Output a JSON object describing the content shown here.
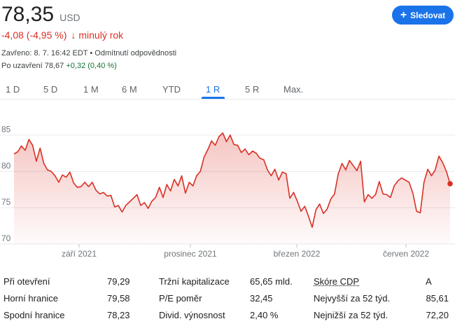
{
  "quote": {
    "price": "78,35",
    "currency": "USD",
    "change": "-4,08 (-4,95 %)",
    "change_arrow": "↓",
    "period": "minulý rok",
    "closed_text": "Zavřeno: 8. 7. 16:42 EDT",
    "separator": "•",
    "disclaimer": "Odmítnutí odpovědnosti",
    "after_hours_label": "Po uzavření 78,67",
    "after_hours_change": "+0,32 (0,40 %)"
  },
  "follow_button": {
    "icon": "plus-icon",
    "label": "Sledovat"
  },
  "range_tabs": [
    "1 D",
    "5 D",
    "1 M",
    "6 M",
    "YTD",
    "1 R",
    "5 R",
    "Max."
  ],
  "active_range": "1 R",
  "colors": {
    "line": "#d93025",
    "accent": "#1a73e8",
    "negative": "#d93025",
    "positive": "#137333"
  },
  "chart_data": {
    "type": "area",
    "y_ticks": [
      "85",
      "80",
      "75",
      "70"
    ],
    "ylim": [
      70,
      87
    ],
    "x_ticks": [
      "září 2021",
      "prosinec 2021",
      "březen 2022",
      "červen 2022"
    ],
    "grid": true,
    "values": [
      82.4,
      82.7,
      83.5,
      82.9,
      84.4,
      83.6,
      81.4,
      83.2,
      81.1,
      80.2,
      80.0,
      79.4,
      78.5,
      79.5,
      79.2,
      79.9,
      78.4,
      77.8,
      77.9,
      78.5,
      77.9,
      78.5,
      77.4,
      76.9,
      77.1,
      76.6,
      76.7,
      75.1,
      75.3,
      74.4,
      75.3,
      75.8,
      76.3,
      76.8,
      75.3,
      75.7,
      74.9,
      75.9,
      76.4,
      77.8,
      76.4,
      78.2,
      77.3,
      78.9,
      78.0,
      79.4,
      77.0,
      78.5,
      78.0,
      79.4,
      80.0,
      82.0,
      83.0,
      84.2,
      83.6,
      84.8,
      85.3,
      84.1,
      85.0,
      83.7,
      83.6,
      82.6,
      83.1,
      82.3,
      82.8,
      82.5,
      81.8,
      81.6,
      80.2,
      79.4,
      80.3,
      78.8,
      79.9,
      79.7,
      76.3,
      77.1,
      75.9,
      74.5,
      75.2,
      73.8,
      72.3,
      74.7,
      75.5,
      74.2,
      74.8,
      76.2,
      76.9,
      79.7,
      81.1,
      80.2,
      81.5,
      80.8,
      80.1,
      81.4,
      75.8,
      76.8,
      76.3,
      76.8,
      78.6,
      76.9,
      76.8,
      76.4,
      78.0,
      78.7,
      79.1,
      78.8,
      78.5,
      77.0,
      74.5,
      74.3,
      78.5,
      80.3,
      79.4,
      80.2,
      82.1,
      81.2,
      80.0,
      78.3
    ]
  },
  "stats": [
    {
      "label": "Při otevření",
      "value": "79,29"
    },
    {
      "label": "Horní hranice",
      "value": "79,58"
    },
    {
      "label": "Spodní hranice",
      "value": "78,23"
    },
    {
      "label": "Tržní kapitalizace",
      "value": "65,65 mld."
    },
    {
      "label": "P/E poměr",
      "value": "32,45"
    },
    {
      "label": "Divid. výnosnost",
      "value": "2,40 %"
    },
    {
      "label": "Skóre CDP",
      "value": "A"
    },
    {
      "label": "Nejvyšší za 52 týd.",
      "value": "85,61"
    },
    {
      "label": "Nejnižší za 52 týd.",
      "value": "72,20"
    }
  ]
}
